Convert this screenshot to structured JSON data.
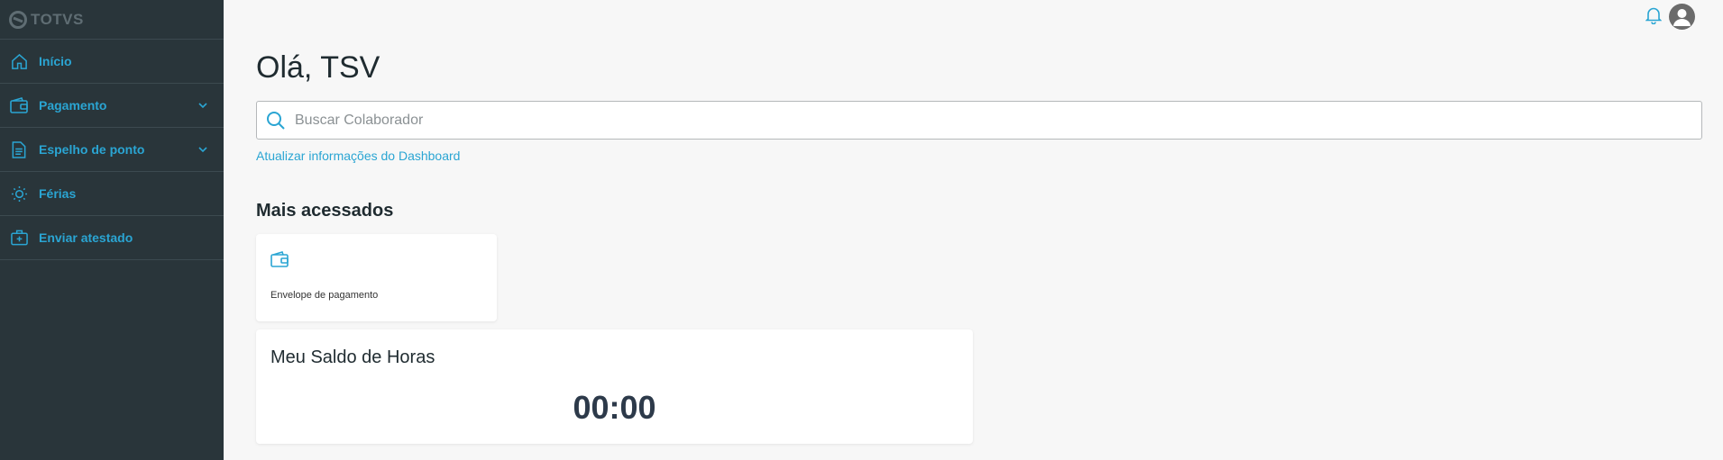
{
  "sidebar": {
    "logo_text": "TOTVS",
    "items": [
      {
        "label": "Início",
        "icon": "home-icon",
        "expandable": false
      },
      {
        "label": "Pagamento",
        "icon": "wallet-icon",
        "expandable": true
      },
      {
        "label": "Espelho de ponto",
        "icon": "document-icon",
        "expandable": true
      },
      {
        "label": "Férias",
        "icon": "sun-icon",
        "expandable": false
      },
      {
        "label": "Enviar atestado",
        "icon": "medical-kit-icon",
        "expandable": false
      }
    ]
  },
  "header": {
    "bell_icon": "bell-icon",
    "avatar_icon": "user-avatar-icon"
  },
  "main": {
    "greeting": "Olá, TSV",
    "search": {
      "placeholder": "Buscar Colaborador",
      "value": ""
    },
    "refresh_link": "Atualizar informações do Dashboard",
    "most_accessed": {
      "title": "Mais acessados",
      "cards": [
        {
          "label": "Envelope de pagamento",
          "icon": "wallet-icon"
        }
      ]
    },
    "hours_card": {
      "title": "Meu Saldo de Horas",
      "value": "00:00"
    }
  },
  "colors": {
    "sidebar_bg": "#29353a",
    "accent": "#2aa5d3",
    "page_bg": "#f7f7f7"
  }
}
